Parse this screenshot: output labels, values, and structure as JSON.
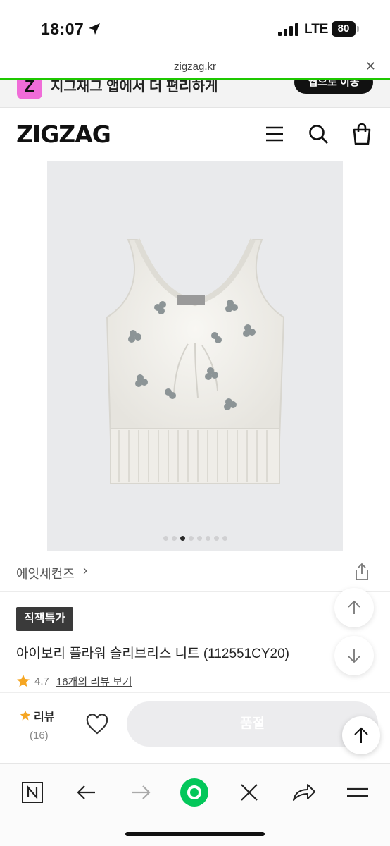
{
  "status_bar": {
    "time": "18:07",
    "network": "LTE",
    "battery": "80"
  },
  "url_bar": {
    "domain": "zigzag.kr"
  },
  "app_banner": {
    "icon_letter": "Z",
    "text": "지그재그 앱에서 더 편리하게",
    "button": "앱으로 이동"
  },
  "header": {
    "logo": "ZIGZAG",
    "icons": [
      "menu-icon",
      "search-icon",
      "shopping-bag-icon"
    ]
  },
  "carousel": {
    "total": 8,
    "current": 3
  },
  "store": {
    "name": "에잇세컨즈"
  },
  "product": {
    "badge": "직잭특가",
    "title": "아이보리 플라워 슬리브리스 니트 (112551CY20)",
    "rating": "4.7",
    "review_link": "16개의 리뷰 보기"
  },
  "purchase_bar": {
    "review_label": "리뷰",
    "review_count": "(16)",
    "main_button": "품절"
  },
  "colors": {
    "accent_star": "#f5a623",
    "progress_green": "#1ec800",
    "badge_bg": "#3a3a3a",
    "naver_green": "#03c75a"
  },
  "browser_toolbar": [
    "naver-home-icon",
    "back-icon",
    "forward-icon",
    "naver-green-button",
    "close-icon",
    "share-icon",
    "menu-icon"
  ]
}
